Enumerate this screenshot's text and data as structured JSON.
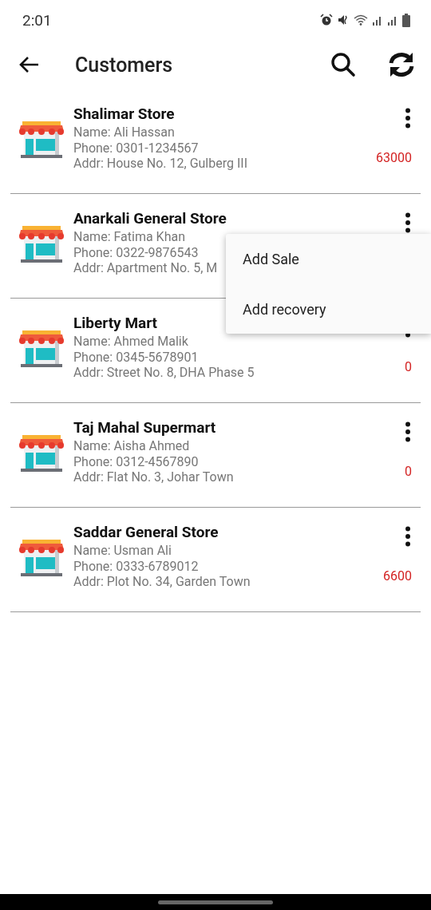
{
  "status_bar": {
    "time": "2:01"
  },
  "app_bar": {
    "title": "Customers"
  },
  "customers": [
    {
      "name": "Shalimar Store",
      "contact": "Name: Ali Hassan",
      "phone": "Phone: 0301-1234567",
      "address": "Addr: House No. 12, Gulberg III",
      "balance": "63000"
    },
    {
      "name": "Anarkali General Store",
      "contact": "Name: Fatima Khan",
      "phone": "Phone: 0322-9876543",
      "address": "Addr: Apartment No. 5, M"
    },
    {
      "name": "Liberty Mart",
      "contact": "Name: Ahmed Malik",
      "phone": "Phone: 0345-5678901",
      "address": "Addr: Street No. 8, DHA Phase 5",
      "balance": "0"
    },
    {
      "name": "Taj Mahal Supermart",
      "contact": "Name: Aisha Ahmed",
      "phone": "Phone: 0312-4567890",
      "address": "Addr: Flat No. 3, Johar Town",
      "balance": "0"
    },
    {
      "name": "Saddar General Store",
      "contact": "Name: Usman Ali",
      "phone": "Phone: 0333-6789012",
      "address": "Addr: Plot No. 34, Garden Town",
      "balance": "6600"
    }
  ],
  "popup_menu": {
    "items": [
      "Add Sale",
      "Add recovery"
    ]
  }
}
